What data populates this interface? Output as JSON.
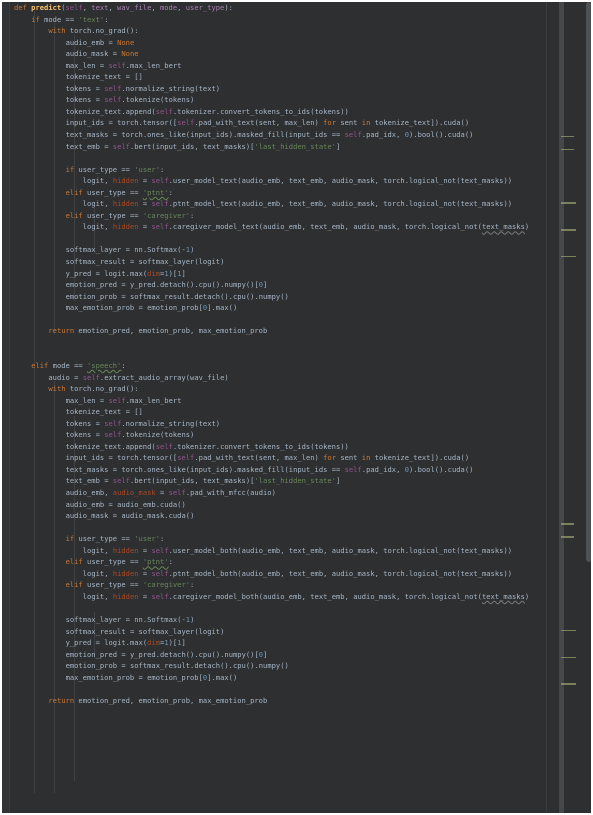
{
  "app": {
    "type": "code-editor",
    "language": "python",
    "theme": "darcula",
    "background": "#2d2f31",
    "gutter_color": "#313335",
    "default_text_color": "#a9b7c6",
    "colors": {
      "keyword": "#cc7832",
      "string": "#6a8759",
      "number": "#6897bb",
      "function": "#ffc66d",
      "self": "#94558d",
      "parameter": "#aa83b4",
      "keyword_argument": "#aa4926",
      "identifier": "#a9b7c6",
      "indent_guide": "#3f4245",
      "minimap_mark": "#8a8d62",
      "scrollbar_thumb": "#4e5254"
    }
  },
  "code": {
    "signature": "def predict(self, text, wav_file, mode, user_type):",
    "lines": [
      "def predict(self, text, wav_file, mode, user_type):",
      "    if mode == 'text':",
      "        with torch.no_grad():",
      "            audio_emb = None",
      "            audio_mask = None",
      "            max_len = self.max_len_bert",
      "            tokenize_text = []",
      "            tokens = self.normalize_string(text)",
      "            tokens = self.tokenize(tokens)",
      "            tokenize_text.append(self.tokenizer.convert_tokens_to_ids(tokens))",
      "            input_ids = torch.tensor([self.pad_with_text(sent, max_len) for sent in tokenize_text]).cuda()",
      "            text_masks = torch.ones_like(input_ids).masked_fill(input_ids == self.pad_idx, 0).bool().cuda()",
      "            text_emb = self.bert(input_ids, text_masks)['last_hidden_state']",
      "",
      "            if user_type == 'user':",
      "                logit, hidden = self.user_model_text(audio_emb, text_emb, audio_mask, torch.logical_not(text_masks))",
      "            elif user_type == 'ptnt':",
      "                logit, hidden = self.ptnt_model_text(audio_emb, text_emb, audio_mask, torch.logical_not(text_masks))",
      "            elif user_type == 'caregiver':",
      "                logit, hidden = self.caregiver_model_text(audio_emb, text_emb, audio_mask, torch.logical_not(text_masks)",
      "",
      "            softmax_layer = nn.Softmax(-1)",
      "            softmax_result = softmax_layer(logit)",
      "            y_pred = logit.max(dim=1)[1]",
      "            emotion_pred = y_pred.detach().cpu().numpy()[0]",
      "            emotion_prob = softmax_result.detach().cpu().numpy()",
      "            max_emotion_prob = emotion_prob[0].max()",
      "",
      "        return emotion_pred, emotion_prob, max_emotion_prob",
      "",
      "",
      "    elif mode == 'speech':",
      "        audio = self.extract_audio_array(wav_file)",
      "        with torch.no_grad():",
      "            max_len = self.max_len_bert",
      "            tokenize_text = []",
      "            tokens = self.normalize_string(text)",
      "            tokens = self.tokenize(tokens)",
      "            tokenize_text.append(self.tokenizer.convert_tokens_to_ids(tokens))",
      "            input_ids = torch.tensor([self.pad_with_text(sent, max_len) for sent in tokenize_text]).cuda()",
      "            text_masks = torch.ones_like(input_ids).masked_fill(input_ids == self.pad_idx, 0).bool().cuda()",
      "            text_emb = self.bert(input_ids, text_masks)['last_hidden_state']",
      "            audio_emb, audio_mask = self.pad_with_mfcc(audio)",
      "            audio_emb = audio_emb.cuda()",
      "            audio_mask = audio_mask.cuda()",
      "",
      "            if user_type == 'user':",
      "                logit, hidden = self.user_model_both(audio_emb, text_emb, audio_mask, torch.logical_not(text_masks))",
      "            elif user_type == 'ptnt':",
      "                logit, hidden = self.ptnt_model_both(audio_emb, text_emb, audio_mask, torch.logical_not(text_masks))",
      "            elif user_type == 'caregiver':",
      "                logit, hidden = self.caregiver_model_both(audio_emb, text_emb, audio_mask, torch.logical_not(text_masks)",
      "",
      "            softmax_layer = nn.Softmax(-1)",
      "            softmax_result = softmax_layer(logit)",
      "            y_pred = logit.max(dim=1)[1]",
      "            emotion_pred = y_pred.detach().cpu().numpy()[0]",
      "            emotion_prob = softmax_result.detach().cpu().numpy()",
      "            max_emotion_prob = emotion_prob[0].max()",
      "",
      "        return emotion_pred, emotion_prob, max_emotion_prob"
    ],
    "spellcheck_warnings": [
      "ptnt",
      "speech",
      "text_masks"
    ],
    "string_literals": [
      "'text'",
      "'last_hidden_state'",
      "'user'",
      "'ptnt'",
      "'caregiver'",
      "'speech'"
    ],
    "keyword_arguments": [
      "dim"
    ],
    "numbers": [
      "0",
      "1",
      "-1"
    ]
  },
  "minimap": {
    "visible": true,
    "marker_count": 10
  },
  "scrollbar": {
    "visible": true,
    "orientation": "vertical",
    "thumb_top_pct": 0,
    "thumb_height_pct": 100
  }
}
